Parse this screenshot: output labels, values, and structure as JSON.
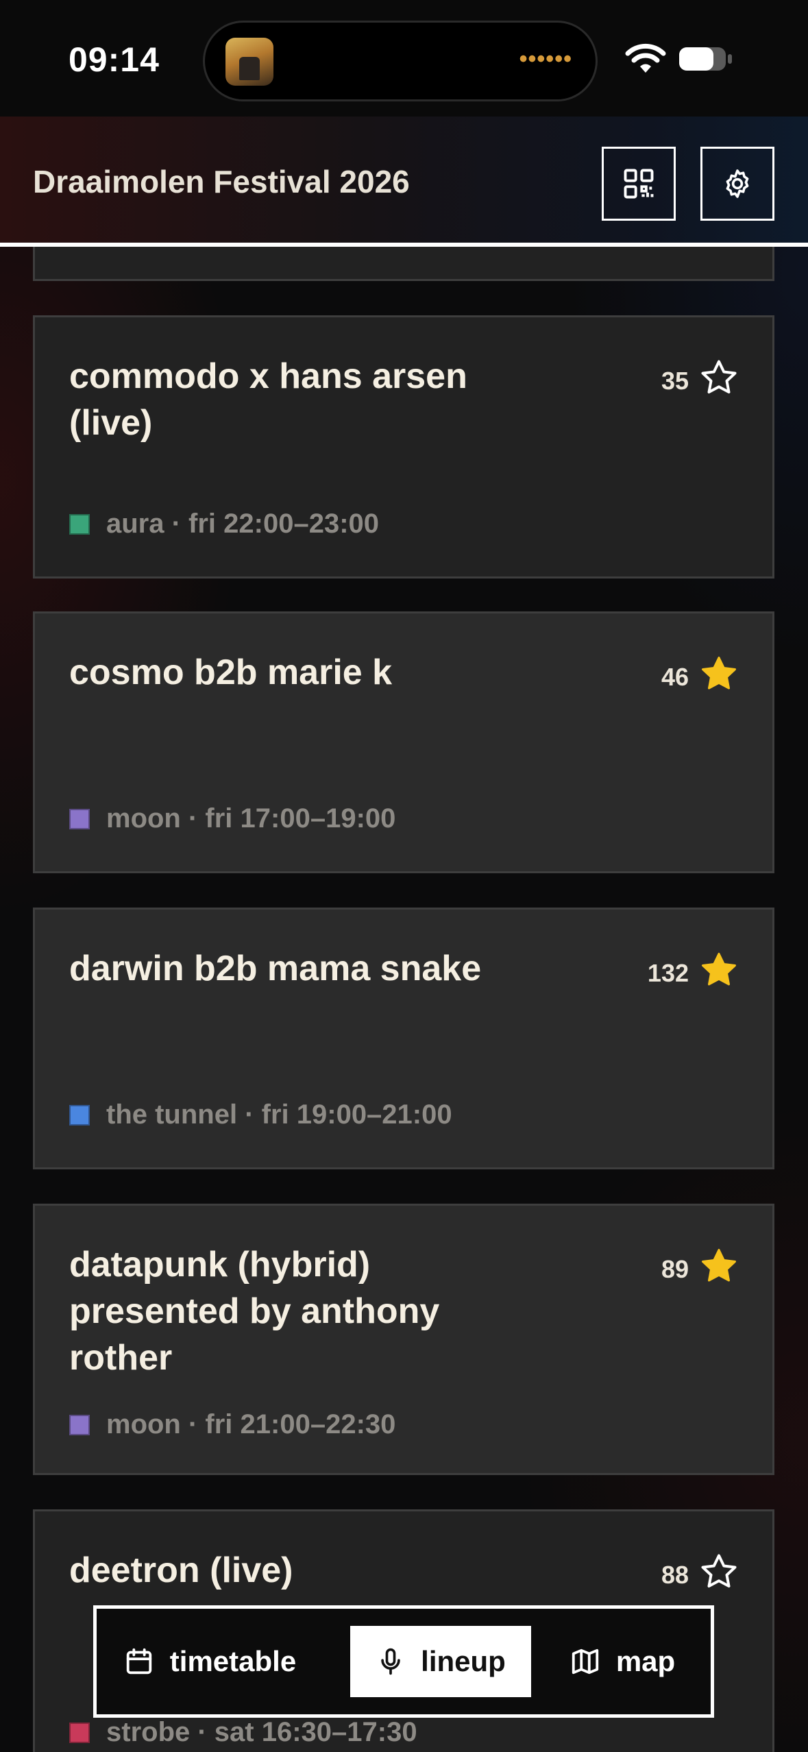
{
  "status_bar": {
    "time": "09:14",
    "island_dots": "••••••"
  },
  "header": {
    "title": "Draaimolen Festival 2026"
  },
  "lineup": [
    {
      "title": "commodo x hans arsen (live)",
      "count": "35",
      "favorited": false,
      "stage_color": "#3aa57a",
      "meta": "aura · fri 22:00–23:00"
    },
    {
      "title": "cosmo b2b marie k",
      "count": "46",
      "favorited": true,
      "stage_color": "#8a74c9",
      "meta": "moon · fri 17:00–19:00"
    },
    {
      "title": "darwin b2b mama snake",
      "count": "132",
      "favorited": true,
      "stage_color": "#4a86e0",
      "meta": "the tunnel · fri 19:00–21:00"
    },
    {
      "title": "datapunk (hybrid) presented by anthony rother",
      "count": "89",
      "favorited": true,
      "stage_color": "#8a74c9",
      "meta": "moon · fri 21:00–22:30"
    },
    {
      "title": "deetron (live)",
      "count": "88",
      "favorited": false,
      "stage_color": "#c93a5a",
      "meta": "strobe · sat 16:30–17:30"
    }
  ],
  "nav": {
    "timetable": "timetable",
    "lineup": "lineup",
    "map": "map",
    "active": "lineup"
  },
  "colors": {
    "star_active": "#f6c21c",
    "star_inactive": "#ffffff",
    "accent": "#ffffff"
  }
}
